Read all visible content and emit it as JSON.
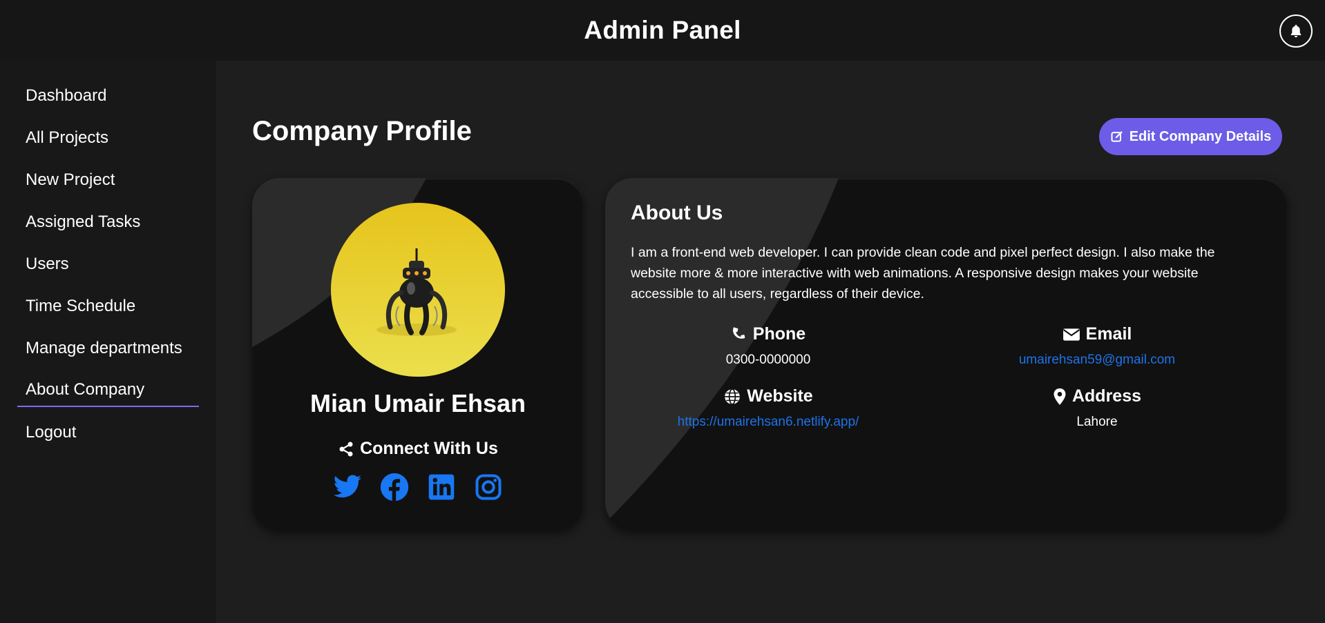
{
  "header": {
    "title": "Admin Panel",
    "notification_icon": "bell-icon"
  },
  "sidebar": {
    "items": [
      {
        "label": "Dashboard",
        "active": false
      },
      {
        "label": "All Projects",
        "active": false
      },
      {
        "label": "New Project",
        "active": false
      },
      {
        "label": "Assigned Tasks",
        "active": false
      },
      {
        "label": "Users",
        "active": false
      },
      {
        "label": "Time Schedule",
        "active": false
      },
      {
        "label": "Manage departments",
        "active": false
      },
      {
        "label": "About Company",
        "active": true
      },
      {
        "label": "Logout",
        "active": false
      }
    ],
    "active_color": "#7b6cf6"
  },
  "page": {
    "title": "Company Profile",
    "edit_button": {
      "label": "Edit Company Details",
      "icon": "edit-icon",
      "color": "#6c5ce7"
    }
  },
  "profile": {
    "name": "Mian Umair Ehsan",
    "connect_label": "Connect With Us",
    "connect_icon": "share-icon",
    "socials": [
      "twitter-icon",
      "facebook-icon",
      "linkedin-icon",
      "instagram-icon"
    ],
    "social_color": "#1877f2"
  },
  "about": {
    "title": "About Us",
    "text": "I am a front-end web developer. I can provide clean code and pixel perfect design. I also make the website more & more interactive with web animations. A responsive design makes your website accessible to all users, regardless of their device.",
    "phone": {
      "label": "Phone",
      "value": "0300-0000000",
      "icon": "phone-icon"
    },
    "email": {
      "label": "Email",
      "value": "umairehsan59@gmail.com",
      "icon": "envelope-icon"
    },
    "website": {
      "label": "Website",
      "value": "https://umairehsan6.netlify.app/",
      "icon": "globe-icon"
    },
    "address": {
      "label": "Address",
      "value": "Lahore",
      "icon": "map-pin-icon"
    },
    "link_color": "#1e73e8"
  }
}
